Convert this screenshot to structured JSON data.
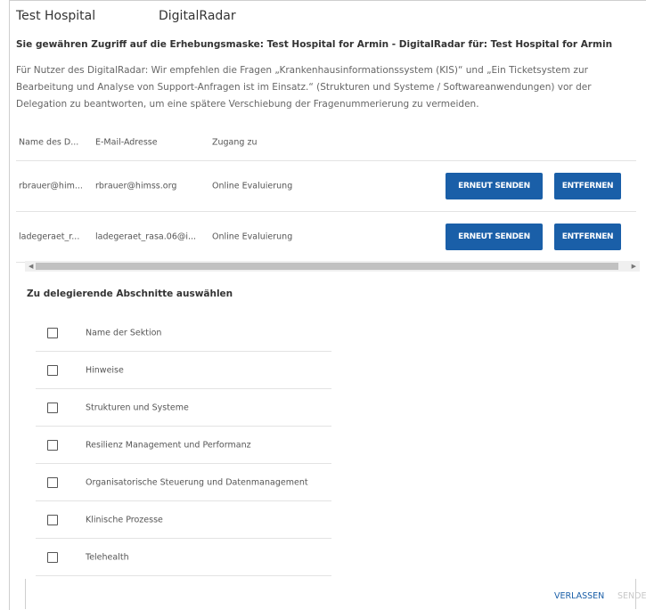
{
  "header": {
    "organization": "Test Hospital",
    "product": "DigitalRadar"
  },
  "subtitle": "Sie gewähren Zugriff auf die Erhebungsmaske: Test Hospital for Armin - DigitalRadar für: Test Hospital for Armin",
  "info": "Für Nutzer des DigitalRadar: Wir empfehlen die Fragen „Krankenhausinformationssystem (KIS)“ und „Ein Ticketsystem zur Bearbeitung und Analyse von Support-Anfragen ist im Einsatz.“ (Strukturen und Systeme / Softwareanwendungen) vor der Delegation zu beantworten, um eine spätere Verschiebung der Fragenummerierung zu vermeiden.",
  "table": {
    "headers": [
      "Name des D...",
      "E-Mail-Adresse",
      "Zugang zu"
    ],
    "rows": [
      {
        "name": "rbrauer@him...",
        "email": "rbrauer@himss.org",
        "access": "Online Evaluierung",
        "resend": "ERNEUT SENDEN",
        "remove": "ENTFERNEN"
      },
      {
        "name": "ladegeraet_r...",
        "email": "ladegeraet_rasa.06@i...",
        "access": "Online Evaluierung",
        "resend": "ERNEUT SENDEN",
        "remove": "ENTFERNEN"
      }
    ]
  },
  "sections": {
    "title": "Zu delegierende Abschnitte auswählen",
    "items": [
      "Name der Sektion",
      "Hinweise",
      "Strukturen und Systeme",
      "Resilienz Management und Performanz",
      "Organisatorische Steuerung und Datenmanagement",
      "Klinische Prozesse",
      "Telehealth"
    ]
  },
  "footer": {
    "leave": "VERLASSEN",
    "send": "SENDE"
  },
  "colors": {
    "primary": "#1a5fa8",
    "disabled": "#c8c8c8"
  }
}
